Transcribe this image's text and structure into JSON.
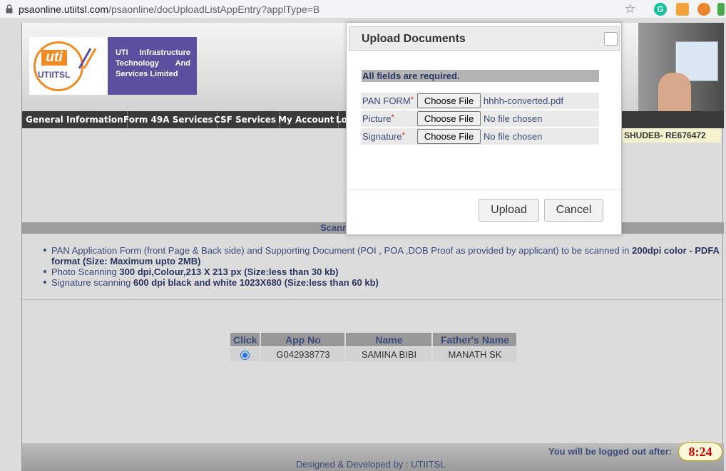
{
  "browser": {
    "url_host": "psaonline.utiitsl.com",
    "url_path": "/psaonline/docUploadListAppEntry?applType=B",
    "ext_grammarly": "G"
  },
  "header": {
    "logo_short": "uti",
    "logo_name": "UTIITSL",
    "logo_text": "UTI Infrastructure Technology And Services Limited"
  },
  "nav": {
    "items": [
      "General Information",
      "Form 49A Services",
      "CSF Services",
      "My Account",
      "Lo"
    ]
  },
  "user": {
    "tag": "SHUDEB- RE676472"
  },
  "section": {
    "title_visible": "Scann"
  },
  "instructions": {
    "items": [
      {
        "text": "PAN Application Form (front Page & Back side) and Supporting Document (POI , POA ,DOB Proof as provided by applicant) to be scanned in ",
        "bold": "200dpi color - PDFA format (Size: Maximum upto 2MB)"
      },
      {
        "text": "Photo Scanning ",
        "bold": "300 dpi,Colour,213 X 213 px (Size:less than 30 kb)"
      },
      {
        "text": "Signature scanning ",
        "bold": "600 dpi black and white 1023X680 (Size:less than 60 kb)"
      }
    ]
  },
  "table": {
    "headers": [
      "Click",
      "App No",
      "Name",
      "Father's Name"
    ],
    "rows": [
      {
        "app_no": "G042938773",
        "name": "SAMINA BIBI",
        "father": "MANATH SK",
        "selected": true
      }
    ]
  },
  "footer": {
    "logout_text": "You will be logged out after:",
    "timer": "8:24",
    "designed": "Designed & Developed by : UTIITSL"
  },
  "modal": {
    "title": "Upload Documents",
    "required_note": "All fields are required.",
    "fields": [
      {
        "label": "PAN FORM",
        "button": "Choose File",
        "file": "hhhh-converted.pdf"
      },
      {
        "label": "Picture",
        "button": "Choose File",
        "file": "No file chosen"
      },
      {
        "label": "Signature",
        "button": "Choose File",
        "file": "No file chosen"
      }
    ],
    "upload_label": "Upload",
    "cancel_label": "Cancel"
  }
}
